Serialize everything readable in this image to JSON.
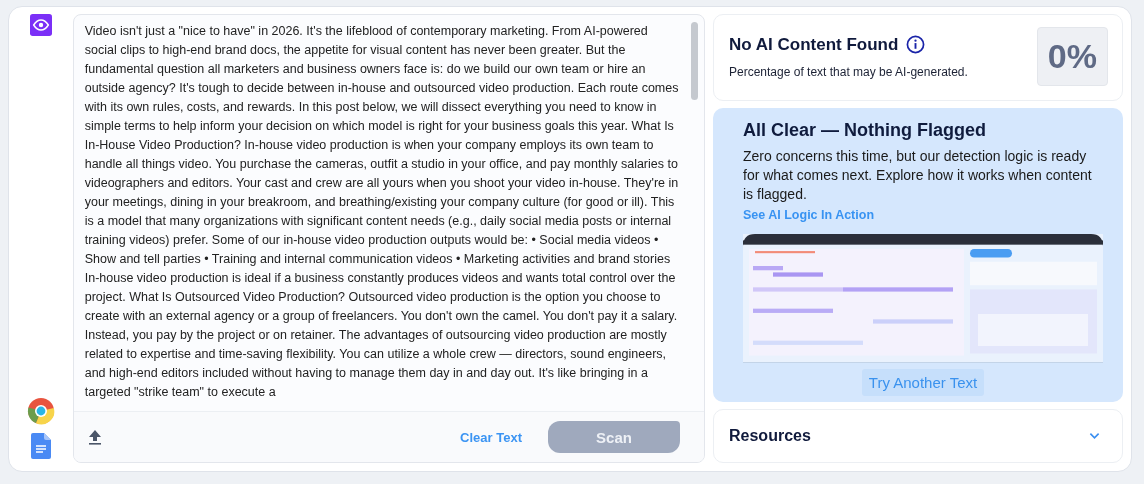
{
  "editor": {
    "text": "Video isn't just a \"nice  to have\" in 2026. It's the lifeblood of contemporary marketing. From AI-powered social clips to high-end brand docs, the appetite for visual content has never been greater. But the fundamental question all marketers and business owners face is: do we build our own team or hire an outside agency? It's tough to decide between in-house and outsourced video production. Each route comes with its own rules, costs, and rewards. In this post below, we will dissect everything you need to know in simple terms to help inform your decision on which model is right for your business goals this year. What Is In-House Video Production? In-house video production is when your company employs its own team to handle all things video. You purchase the cameras, outfit a studio in your office, and pay monthly salaries to videographers and editors. Your cast and crew are all yours when you shoot your video  in-house. They're in your meetings, dining in your breakroom, and breathing/existing your company culture (for good or ill). This is a model that many organizations with significant content needs (e.g., daily social media posts or internal training videos) prefer. Some of our in-house video production  outputs would be: • Social media videos • Show and tell parties • Training and  internal communication videos • Marketing activities and  brand stories In-house video production is ideal if a business constantly produces videos and wants total control over the project. What Is Outsourced Video Production? Outsourced video production is the option you choose to create with an external agency or a group of freelancers. You don't own  the camel. You don't pay it a salary. Instead, you pay by the project or on retainer. The advantages of outsourcing video production are mostly related to expertise and time-saving flexibility. You can utilize a whole crew — directors, sound engineers, and high-end editors included without having to manage them day in and day out. It's like bringing in a  targeted \"strike team\" to execute a",
    "clear": "Clear Text",
    "scan": {
      "label": "Scan",
      "disabled": true
    }
  },
  "result": {
    "title": "No AI Content Found",
    "subtitle": "Percentage of text that may be AI-generated.",
    "score": "0%"
  },
  "notice": {
    "title": "All Clear — Nothing Flagged",
    "body": "Zero concerns this time, but our detection logic is ready for what comes next. Explore how it works when content is flagged.",
    "link": "See AI Logic In Action",
    "button": "Try Another Text"
  },
  "resources": {
    "title": "Resources",
    "expanded": false
  }
}
